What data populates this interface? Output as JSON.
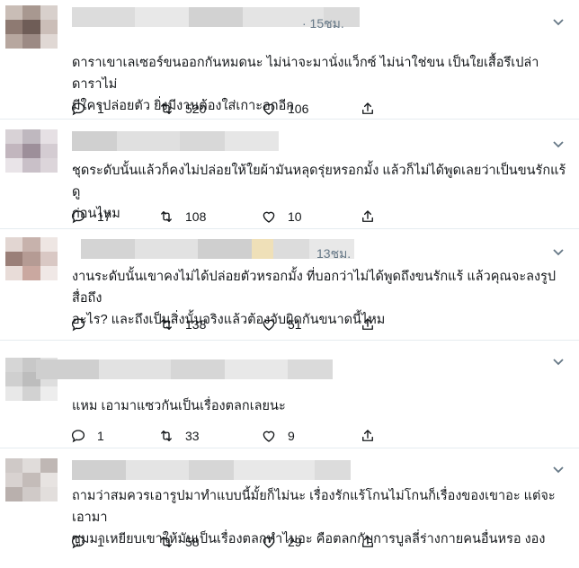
{
  "replies": [
    {
      "timestamp": "· 15ชม.",
      "text_lines": [
        "ดาราเขาเลเซอร์ขนออกกันหมดนะ ไม่น่าจะมานั่งแว็กซ์ ไม่น่าใช่ขน เป็นใยเสื้อรึเปล่า ดาราไม่",
        "มีใครปล่อยตัว ยิ่งมีงานต้องใส่เกาะอกอีก"
      ],
      "replies": "1",
      "retweets": "520",
      "likes": "106"
    },
    {
      "timestamp": "",
      "text_lines": [
        "ชุดระดับนั้นแล้วก็คงไม่ปล่อยให้ใยผ้ามันหลุดรุ่ยหรอกมั้ง แล้วก็ไม่ได้พูดเลยว่าเป็นขนรักแร้ ดู",
        "ก่อนไหม"
      ],
      "replies": "17",
      "retweets": "108",
      "likes": "10"
    },
    {
      "timestamp": "13ชม.",
      "text_lines": [
        "งานระดับนั้นเขาคงไม่ได้ปล่อยตัวหรอกมั้ง ที่บอกว่าไม่ได้พูดถึงขนรักแร้ แล้วคุณจะลงรูปสื่อถึง",
        "อะไร? และถึงเป็นสิ่งนั้นจริงแล้วต้องจับผิดกันขนาดนี้ไหม"
      ],
      "replies": "",
      "retweets": "138",
      "likes": "51"
    },
    {
      "timestamp": "",
      "text_lines": [
        "แหม เอามาแซวกันเป็นเรื่องตลกเลยนะ"
      ],
      "replies": "1",
      "retweets": "33",
      "likes": "9"
    },
    {
      "timestamp": "",
      "text_lines": [
        "ถามว่าสมควรเอารูปมาทำแบบนี้มั้ยก็ไม่นะ เรื่องรักแร้โกนไม่โกนก็เรื่องของเขาอะ แต่จะเอามา",
        "ซูมมาเหยียบเขาให้มันเป็นเรื่องตลกทำไมอะ คือตลกกับการบูลลี่ร่างกายคนอื่นหรอ งอง"
      ],
      "replies": "1",
      "retweets": "58",
      "likes": "29"
    }
  ],
  "colors": {
    "text": "#14171a",
    "secondary": "#657786",
    "divider": "#e6ecf0"
  },
  "icons": {
    "reply": "reply-icon",
    "retweet": "retweet-icon",
    "like": "like-icon",
    "share": "share-icon",
    "menu": "chevron-down-icon"
  }
}
